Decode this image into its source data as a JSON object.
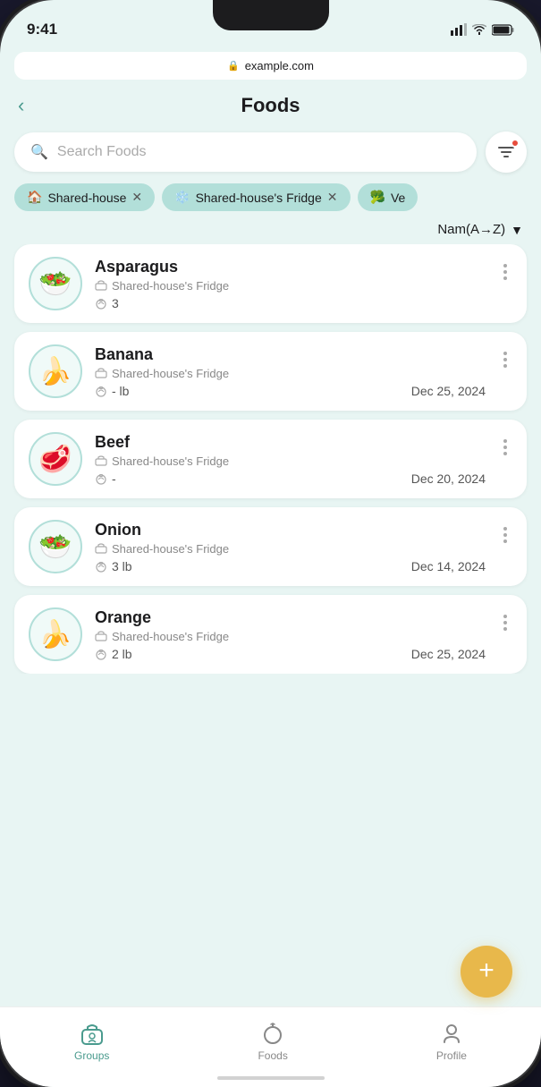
{
  "status_bar": {
    "time": "9:41",
    "url": "example.com"
  },
  "header": {
    "back_label": "‹",
    "title": "Foods"
  },
  "search": {
    "placeholder": "Search Foods"
  },
  "tags": [
    {
      "id": "tag-0",
      "icon": "🏠",
      "label": "Shared-house",
      "removable": true
    },
    {
      "id": "tag-1",
      "icon": "❄️",
      "label": "Shared-house's Fridge",
      "removable": true
    },
    {
      "id": "tag-2",
      "icon": "🥦",
      "label": "Ve",
      "removable": false
    }
  ],
  "sort": {
    "label": "Nam(A→Z)",
    "arrow": "▼"
  },
  "foods": [
    {
      "name": "Asparagus",
      "emoji": "🥗",
      "location": "Shared-house's Fridge",
      "quantity": "3",
      "unit": "",
      "date": ""
    },
    {
      "name": "Banana",
      "emoji": "🍌",
      "location": "Shared-house's Fridge",
      "quantity": "- lb",
      "unit": "",
      "date": "Dec 25, 2024"
    },
    {
      "name": "Beef",
      "emoji": "🥩",
      "location": "Shared-house's Fridge",
      "quantity": "-",
      "unit": "",
      "date": "Dec 20, 2024"
    },
    {
      "name": "Onion",
      "emoji": "🥗",
      "location": "Shared-house's Fridge",
      "quantity": "3 lb",
      "unit": "",
      "date": "Dec 14, 2024"
    },
    {
      "name": "Orange",
      "emoji": "🍌",
      "location": "Shared-house's Fridge",
      "quantity": "2 lb",
      "unit": "",
      "date": "Dec 25, 2024"
    }
  ],
  "fab": {
    "label": "+"
  },
  "bottom_nav": [
    {
      "id": "nav-groups",
      "icon": "🏠",
      "label": "Groups",
      "active": true
    },
    {
      "id": "nav-foods",
      "icon": "🍎",
      "label": "Foods",
      "active": false
    },
    {
      "id": "nav-profile",
      "icon": "👤",
      "label": "Profile",
      "active": false
    }
  ],
  "icons": {
    "search": "🔍",
    "filter": "⊞",
    "box": "📦",
    "weight": "⚖",
    "more_dots": "•••"
  }
}
